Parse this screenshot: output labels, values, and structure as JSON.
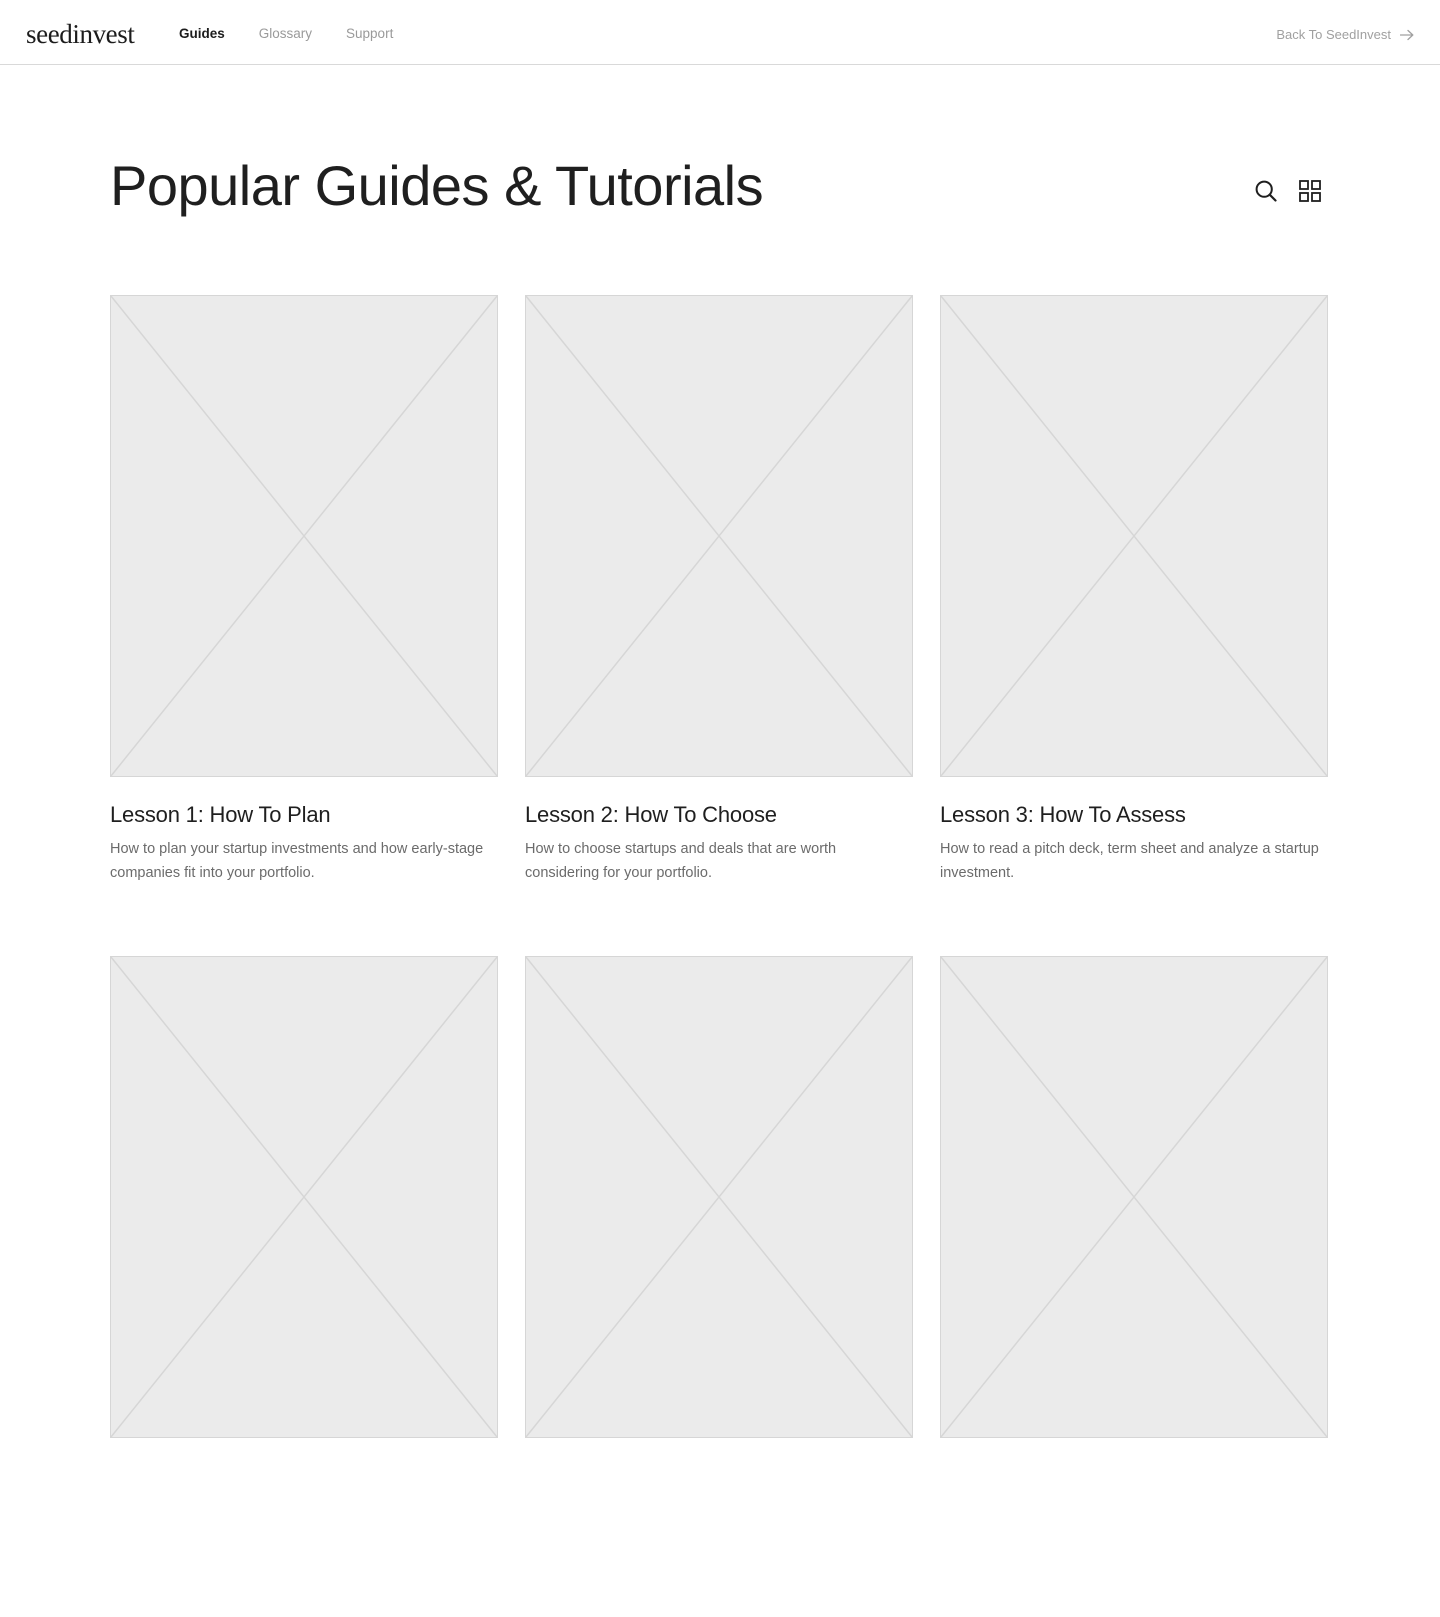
{
  "header": {
    "logo_text": "seedinvest",
    "nav": [
      {
        "label": "Guides",
        "active": true
      },
      {
        "label": "Glossary",
        "active": false
      },
      {
        "label": "Support",
        "active": false
      }
    ],
    "back_link_label": "Back To SeedInvest",
    "back_link_icon": "arrow-right-icon"
  },
  "main": {
    "title": "Popular Guides & Tutorials",
    "tools": [
      {
        "icon": "search-icon"
      },
      {
        "icon": "grid-view-icon"
      }
    ],
    "cards": [
      {
        "title": "Lesson 1: How To Plan",
        "description": "How to plan your startup investments and how early-stage companies fit into your portfolio."
      },
      {
        "title": "Lesson 2: How To Choose",
        "description": "How to choose startups and deals that are worth considering for your portfolio."
      },
      {
        "title": "Lesson 3: How To Assess",
        "description": "How to read a pitch deck, term sheet and analyze a startup investment."
      },
      {
        "title": "",
        "description": ""
      },
      {
        "title": "",
        "description": ""
      },
      {
        "title": "",
        "description": ""
      }
    ]
  },
  "colors": {
    "placeholder_fill": "#ebebeb",
    "placeholder_stroke": "#d6d6d6",
    "nav_inactive": "#9a9a9a",
    "text_dark": "#1f1f1f"
  }
}
